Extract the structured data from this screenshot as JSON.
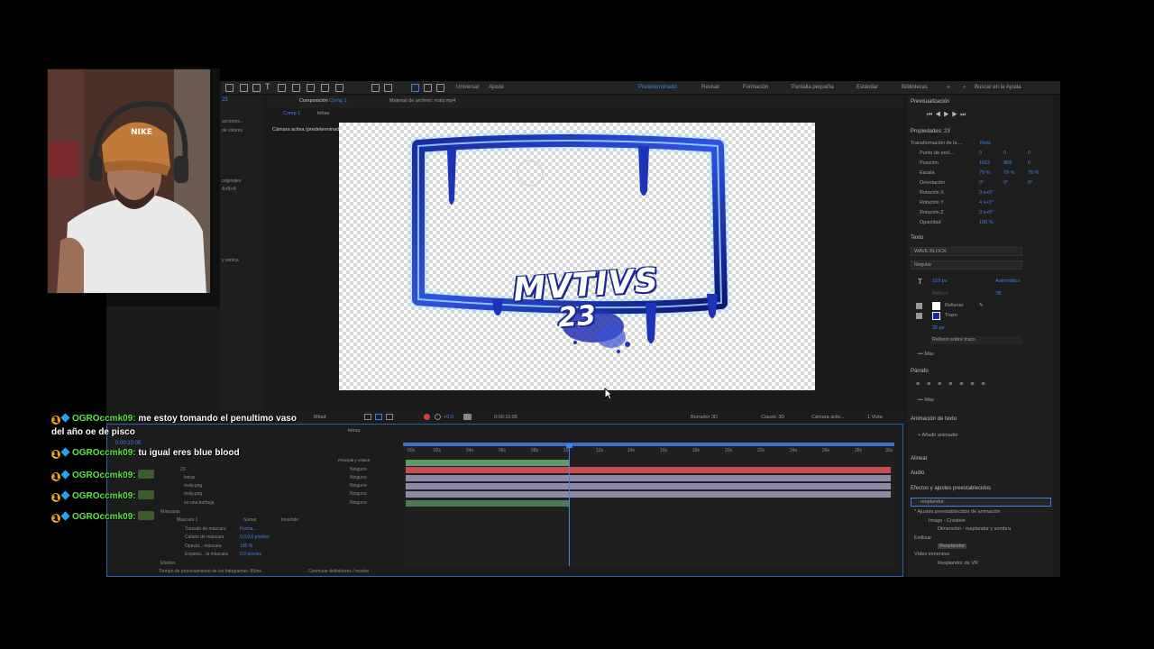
{
  "toolbar": {
    "tools": [
      "home-icon",
      "select-icon",
      "hand-icon",
      "zoom-icon",
      "camera-icon",
      "pen-icon",
      "type-icon",
      "brush-icon",
      "stamp-icon",
      "eraser-icon",
      "roto-icon",
      "puppet-icon"
    ],
    "universal_label": "Universal",
    "ajuste_label": "Ajuste",
    "workspaces": [
      "Predeterminado",
      "Revisar",
      "Formación",
      "Pantalla pequeña",
      "Estándar",
      "Bibliotecas"
    ],
    "active_workspace": "Predeterminado",
    "search_placeholder": "Buscar en la Ayuda"
  },
  "left_panel": {
    "items": [
      "acciones...",
      "de colores",
      "originales",
      "A>B>A",
      "y vertica"
    ]
  },
  "composition": {
    "tab_label": "Composición",
    "tab_comp": "Comp 1",
    "footage_label": "Material de archivo: maty.mp4",
    "subtab_comp": "Comp 1",
    "subtab_layer": "letras",
    "active_camera": "Cámara activa (predeterminada)"
  },
  "canvas": {
    "title_line1": "MVTIVS",
    "title_line2": "23"
  },
  "viewer_bar": {
    "resolution": "Mitad",
    "timecode": "0:00:10:05",
    "exposure": "+0.0",
    "renderer": "Borrador 3D",
    "renderer_mode": "Classic 3D",
    "camera": "Cámara activ...",
    "views": "1 Vista"
  },
  "preview": {
    "title": "Previsualización"
  },
  "properties": {
    "title": "Propiedades: 23",
    "transform_label": "Transformación de la ...",
    "reset_label": "Rest.",
    "rows": [
      {
        "label": "Punto de ancl...",
        "v1": "0",
        "v2": "0",
        "v3": "0"
      },
      {
        "label": "Posición",
        "v1": "1012",
        "v2": "869",
        "v3": "0"
      },
      {
        "label": "Escala",
        "v1": "79 %",
        "v2": "79 %",
        "v3": "79 %"
      },
      {
        "label": "Orientación",
        "v1": "0°",
        "v2": "0°",
        "v3": "0°"
      },
      {
        "label": "Rotación X",
        "v1": "0 x+0°",
        "v2": "",
        "v3": ""
      },
      {
        "label": "Rotación Y",
        "v1": "4 x+3°",
        "v2": "",
        "v3": ""
      },
      {
        "label": "Rotación Z",
        "v1": "0 x+0°",
        "v2": "",
        "v3": ""
      },
      {
        "label": "Opacidad",
        "v1": "100 %",
        "v2": "",
        "v3": ""
      }
    ]
  },
  "text_panel": {
    "title": "Texto",
    "font": "WAVE BLOCK",
    "style": "Regular",
    "size": "219 px",
    "leading": "Automático",
    "kerning": "Métrico",
    "tracking": "78",
    "fill_label": "Rellenar",
    "stroke_label": "Trazo",
    "stroke_size": "32 px",
    "stroke_mode": "Relleno sobre trazo",
    "more_label": "Más"
  },
  "paragraph_panel": {
    "title": "Párrafo",
    "more_label": "Más"
  },
  "text_animation": {
    "title": "Animación de texto",
    "add_label": "Añadir animador"
  },
  "align_label": "Alinear",
  "audio_label": "Audio",
  "effects_panel": {
    "title": "Efectos y ajustes preestablecidos",
    "search_value": "resplandor",
    "items": [
      "* Ajustes preestablecidos de animación",
      "Image - Creative",
      "Dimensión - resplandor y sombra",
      "Estilizar",
      "Resplandor",
      "Vídeo inmersivo",
      "Resplandor de VR"
    ]
  },
  "timeline": {
    "tab_label": "letras",
    "timecode": "0:00:10:05",
    "search_hint": "procesamiento",
    "ruler": [
      "00s",
      "02s",
      "04s",
      "06s",
      "08s",
      "10",
      "12s",
      "14s",
      "16s",
      "18s",
      "20s",
      "22s",
      "24s",
      "26s",
      "28s",
      "30s"
    ],
    "parent_header": "Principal y enlace",
    "layers": [
      {
        "num": "1",
        "name": "23",
        "parent": "Ninguno"
      },
      {
        "num": "2",
        "name": "letras",
        "parent": "Ninguno"
      },
      {
        "num": "3",
        "name": "maty.png",
        "parent": "Ninguno"
      },
      {
        "num": "4",
        "name": "maty.png",
        "parent": "Ninguno"
      },
      {
        "num": "5",
        "name": "en una burbuja",
        "parent": "Ninguno"
      }
    ],
    "mask_group": "Máscaras",
    "mask_name": "Máscara 1",
    "mask_mode": "Sumar",
    "mask_inverted": "Invertido",
    "mask_props": [
      {
        "label": "Trazado de máscara",
        "value": "Forma..."
      },
      {
        "label": "Calado de máscara",
        "value": "0,0,0,0 píxeles"
      },
      {
        "label": "Opacid... máscara",
        "value": "100 %"
      },
      {
        "label": "Expansi... la máscara",
        "value": "0,0 píxeles"
      }
    ],
    "effects_label": "Efectos",
    "footer_render": "Tiempo de procesamiento de los fotogramas: 85ms",
    "footer_toggle": "Conmutar definidores / modos"
  },
  "chat": [
    {
      "user": "OGROccmk09:",
      "text": "me estoy tomando el penultimo vaso",
      "cont": "del año oe de pisco",
      "emote": false
    },
    {
      "user": "OGROccmk09:",
      "text": "tu igual eres blue blood",
      "cont": "",
      "emote": false
    },
    {
      "user": "OGROccmk09:",
      "text": "",
      "cont": "",
      "emote": true
    },
    {
      "user": "OGROccmk09:",
      "text": "",
      "cont": "",
      "emote": true
    },
    {
      "user": "OGROccmk09:",
      "text": "",
      "cont": "",
      "emote": true
    }
  ],
  "colors": {
    "accent": "#3d82e6",
    "track_red": "#c94b54",
    "track_gray": "#8c8aa6",
    "track_green": "#5c9b6b",
    "chat_username": "#5ee04a"
  }
}
